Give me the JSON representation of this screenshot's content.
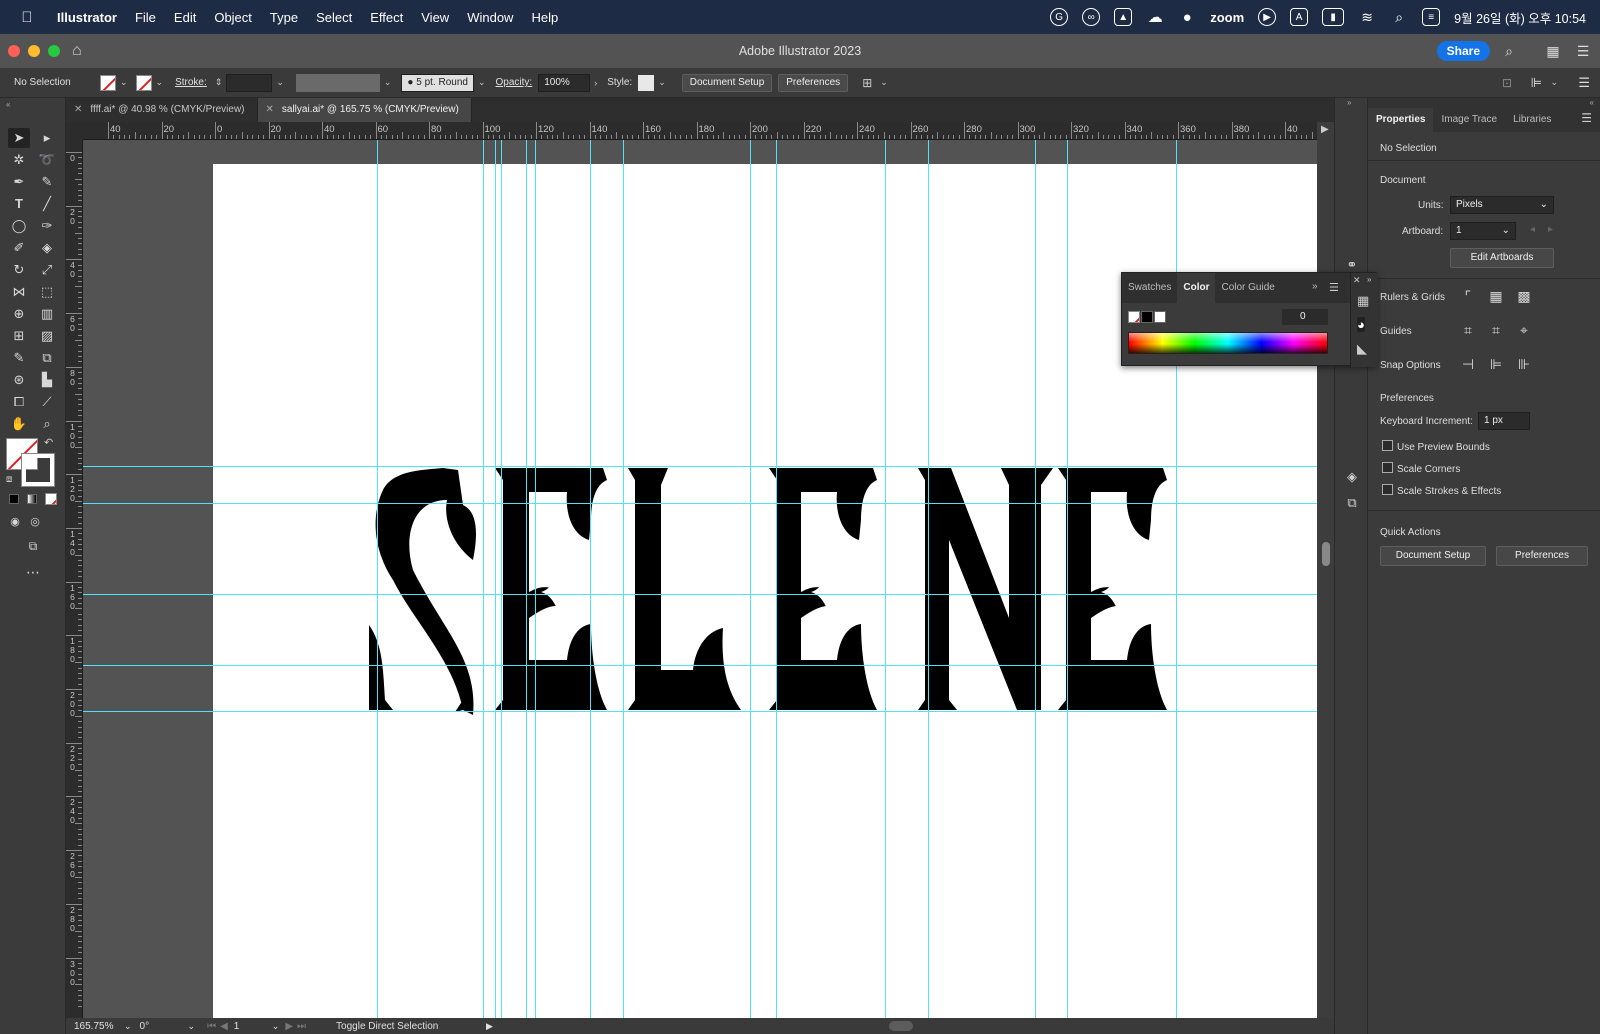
{
  "menubar": {
    "app": "Illustrator",
    "items": [
      "File",
      "Edit",
      "Object",
      "Type",
      "Select",
      "Effect",
      "View",
      "Window",
      "Help"
    ],
    "zoom_label": "zoom",
    "input_indicator": "A",
    "clock": "9월 26일 (화) 오후 10:54"
  },
  "titlebar": {
    "title": "Adobe Illustrator 2023",
    "share": "Share"
  },
  "controlbar": {
    "selection": "No Selection",
    "stroke_label": "Stroke:",
    "brush": "5 pt. Round",
    "opacity_label": "Opacity:",
    "opacity_value": "100%",
    "style_label": "Style:",
    "document_setup": "Document Setup",
    "preferences": "Preferences"
  },
  "tabs": [
    {
      "label": "ffff.ai* @ 40.98 % (CMYK/Preview)",
      "active": false
    },
    {
      "label": "sallyai.ai* @ 165.75 % (CMYK/Preview)",
      "active": true
    }
  ],
  "ruler_h": [
    "40",
    "20",
    "0",
    "20",
    "40",
    "60",
    "80",
    "100",
    "120",
    "140",
    "160",
    "180",
    "200",
    "220",
    "240",
    "260",
    "280",
    "300",
    "320",
    "340",
    "360",
    "380",
    "40"
  ],
  "ruler_v": [
    "0",
    "20",
    "40",
    "60",
    "80",
    "100",
    "120",
    "140",
    "160",
    "180",
    "200",
    "220",
    "240",
    "260",
    "280",
    "300"
  ],
  "artwork": {
    "text": "SELENE",
    "fill": "#000000",
    "guide_color": "#4fe3f5"
  },
  "statusbar": {
    "zoom": "165.75%",
    "rotation": "0°",
    "artboard": "1",
    "status": "Toggle Direct Selection"
  },
  "properties": {
    "tabs": [
      "Properties",
      "Image Trace",
      "Libraries"
    ],
    "selection": "No Selection",
    "document_heading": "Document",
    "units_label": "Units:",
    "units_value": "Pixels",
    "artboard_label": "Artboard:",
    "artboard_value": "1",
    "edit_artboards": "Edit Artboards",
    "rulers_grids": "Rulers & Grids",
    "guides": "Guides",
    "snap_options": "Snap Options",
    "preferences_heading": "Preferences",
    "keyboard_increment_label": "Keyboard Increment:",
    "keyboard_increment_value": "1 px",
    "use_preview_bounds": "Use Preview Bounds",
    "scale_corners": "Scale Corners",
    "scale_strokes": "Scale Strokes & Effects",
    "quick_actions": "Quick Actions",
    "document_setup": "Document Setup",
    "preferences": "Preferences"
  },
  "colorpanel": {
    "tabs": [
      "Swatches",
      "Color",
      "Color Guide"
    ],
    "value": "0"
  },
  "colors": {
    "accent": "#1473e6",
    "guide": "#4fe3f5",
    "menubar_bg": "#1e2b45"
  }
}
